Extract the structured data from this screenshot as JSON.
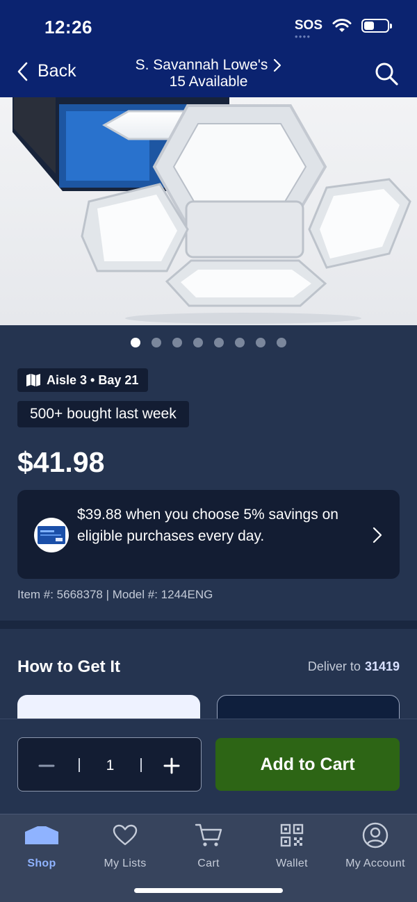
{
  "status_bar": {
    "time": "12:26",
    "sos": "SOS",
    "battery_level": 0.45
  },
  "nav": {
    "back_label": "Back",
    "store_name": "S. Savannah Lowe's",
    "availability": "15 Available"
  },
  "gallery": {
    "image_count": 8,
    "active_index": 0
  },
  "product": {
    "aisle": "Aisle 3 • Bay 21",
    "social_proof": "500+ bought last week",
    "price": "$41.98",
    "promo": "$39.88 when you choose 5% savings on eligible purchases every day.",
    "item_meta": "Item #: 5668378 | Model #: 1244ENG"
  },
  "how_to_get_it": {
    "title": "How to Get It",
    "deliver_to_label": "Deliver to",
    "zip": "31419"
  },
  "purchase": {
    "quantity": "1",
    "add_to_cart_label": "Add to Cart"
  },
  "tabs": [
    {
      "label": "Shop",
      "icon": "shop-icon"
    },
    {
      "label": "My Lists",
      "icon": "heart-icon"
    },
    {
      "label": "Cart",
      "icon": "cart-icon"
    },
    {
      "label": "Wallet",
      "icon": "qr-code-icon"
    },
    {
      "label": "My Account",
      "icon": "account-icon"
    }
  ],
  "colors": {
    "header": "#0b2370",
    "page_bg": "#253450",
    "card_bg": "#131d33",
    "add_to_cart": "#2d6515",
    "active_tab": "#8fb3ff"
  }
}
